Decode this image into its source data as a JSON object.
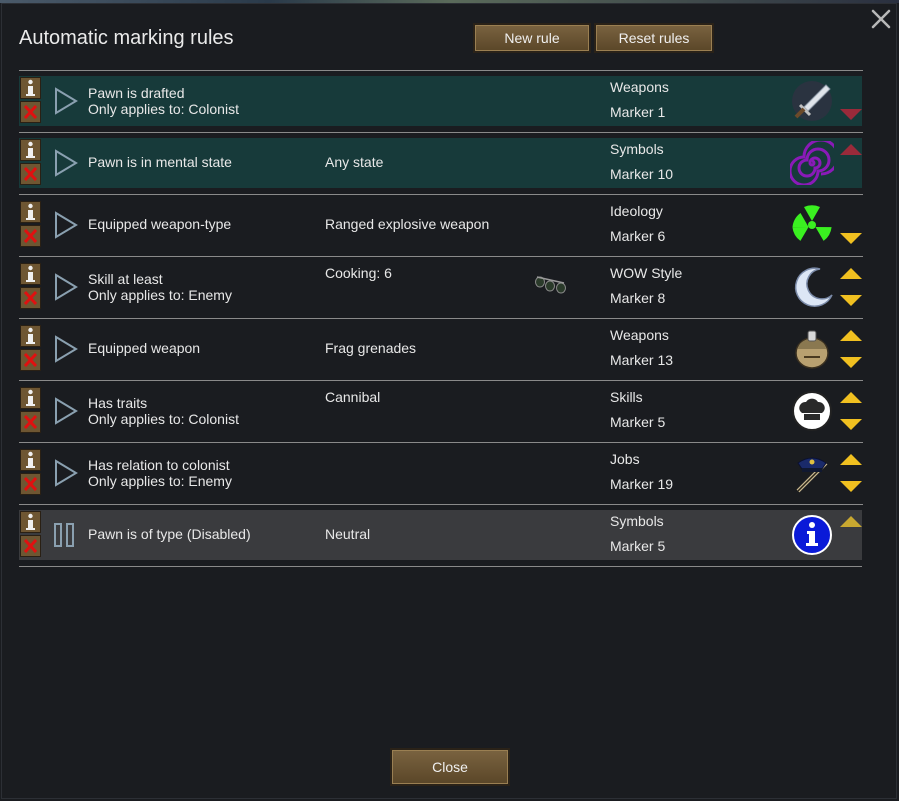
{
  "window": {
    "title": "Automatic marking rules"
  },
  "toolbar": {
    "new_rule": "New rule",
    "reset_rules": "Reset rules"
  },
  "footer": {
    "close": "Close"
  },
  "rules": [
    {
      "condition": "Pawn is drafted",
      "applies": "Only applies to: Colonist",
      "value": "",
      "category": "Weapons",
      "marker": "Marker 1",
      "icon": "sword-icon",
      "state": "active"
    },
    {
      "condition": "Pawn is in mental state",
      "applies": "",
      "value": "Any state",
      "category": "Symbols",
      "marker": "Marker 10",
      "icon": "spiral-icon",
      "state": "active"
    },
    {
      "condition": "Equipped weapon-type",
      "applies": "",
      "value": "Ranged explosive weapon",
      "category": "Ideology",
      "marker": "Marker 6",
      "icon": "radiation-icon",
      "state": "normal"
    },
    {
      "condition": "Skill at least",
      "applies": "Only applies to: Enemy",
      "value": "Cooking: 6",
      "category": "WOW Style",
      "marker": "Marker 8",
      "icon": "crescent-moon-icon",
      "state": "normal"
    },
    {
      "condition": "Equipped weapon",
      "applies": "",
      "value": "Frag grenades",
      "category": "Weapons",
      "marker": "Marker 13",
      "icon": "helmet-icon",
      "state": "normal"
    },
    {
      "condition": "Has traits",
      "applies": "Only applies to: Colonist",
      "value": "Cannibal",
      "category": "Skills",
      "marker": "Marker 5",
      "icon": "chef-hat-icon",
      "state": "normal"
    },
    {
      "condition": "Has relation to colonist",
      "applies": "Only applies to: Enemy",
      "value": "",
      "category": "Jobs",
      "marker": "Marker 19",
      "icon": "police-icon",
      "state": "normal"
    },
    {
      "condition": "Pawn is of type (Disabled)",
      "applies": "",
      "value": "Neutral",
      "category": "Symbols",
      "marker": "Marker 5",
      "icon": "info-icon",
      "state": "disabled"
    }
  ],
  "colors": {
    "active_row": "#173a3a",
    "disabled_row": "#3a3b3e",
    "button": "#6b5433",
    "arrow_yellow": "#f0c020",
    "arrow_red": "#9a2a3a"
  }
}
